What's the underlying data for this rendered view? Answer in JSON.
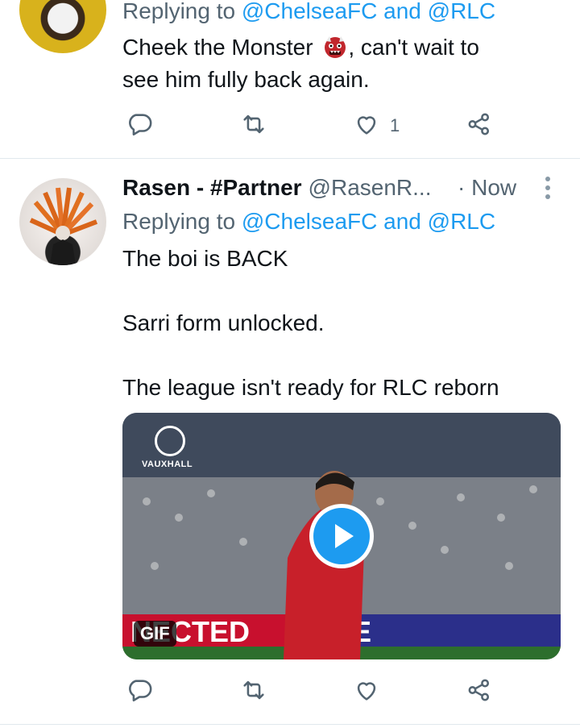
{
  "tweet1": {
    "replying_prefix": "Replying to",
    "mention_a": "@ChelseaFC",
    "and": "and",
    "mention_b": "@RLC",
    "text_line1_a": "Cheek the Monster",
    "text_line1_b": ", can't wait to",
    "text_line2": "see him fully back again.",
    "like_count": "1"
  },
  "tweet2": {
    "name": "Rasen - #Partner",
    "handle": "@RasenR...",
    "time": "· Now",
    "replying_prefix": "Replying to",
    "mention_a": "@ChelseaFC",
    "and": "and",
    "mention_b": "@RLC",
    "line1": "The boi is BACK",
    "line2": "Sarri form unlocked.",
    "line3": "The league isn't ready for RLC reborn",
    "media": {
      "badge": "GIF",
      "sponsor": "VAUXHALL"
    }
  },
  "icons": {
    "reply": "reply-icon",
    "retweet": "retweet-icon",
    "like": "like-icon",
    "share": "share-icon",
    "more": "more-icon",
    "play": "play-icon",
    "emoji": "ogre-emoji"
  },
  "colors": {
    "accent": "#1d9bf0",
    "secondary_text": "#536471",
    "divider": "#e1e8ed"
  }
}
